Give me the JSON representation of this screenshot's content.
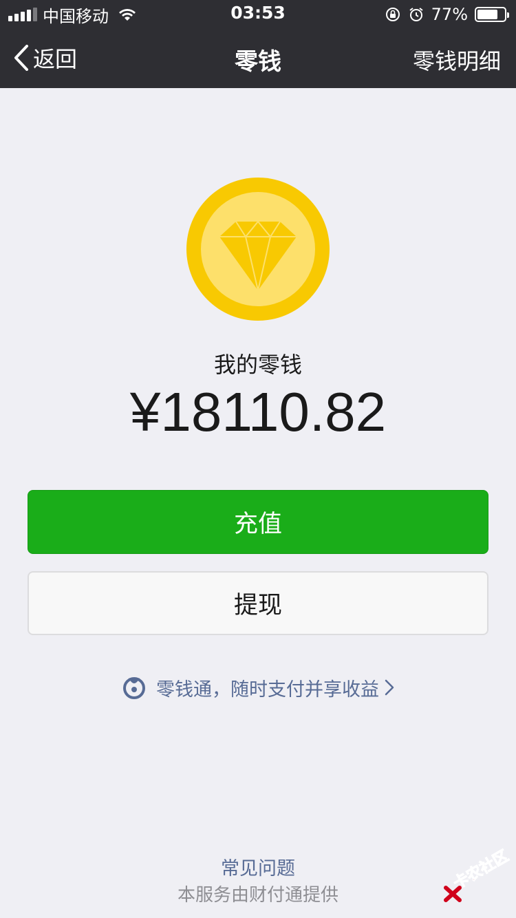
{
  "status_bar": {
    "carrier": "中国移动",
    "time": "03:53",
    "battery_percent": "77%",
    "battery_level": 0.77,
    "signal_bars_on": 4,
    "icons": [
      "signal-icon",
      "wifi-icon",
      "orientation-lock-icon",
      "alarm-icon",
      "battery-icon"
    ]
  },
  "nav": {
    "back_label": "返回",
    "title": "零钱",
    "right_label": "零钱明细"
  },
  "balance": {
    "label": "我的零钱",
    "amount": "¥18110.82"
  },
  "actions": {
    "recharge_label": "充值",
    "withdraw_label": "提现"
  },
  "promo": {
    "text": "零钱通，随时支付并享收益"
  },
  "footer": {
    "faq": "常见问题",
    "provider": "本服务由财付通提供"
  },
  "watermark": {
    "text": "卡农社区"
  },
  "colors": {
    "nav_background": "#2e2e33",
    "page_background": "#efeff4",
    "primary_green": "#1aad19",
    "link_blue": "#576b95",
    "coin_outer": "#f8c902",
    "coin_inner": "#fde06b"
  }
}
